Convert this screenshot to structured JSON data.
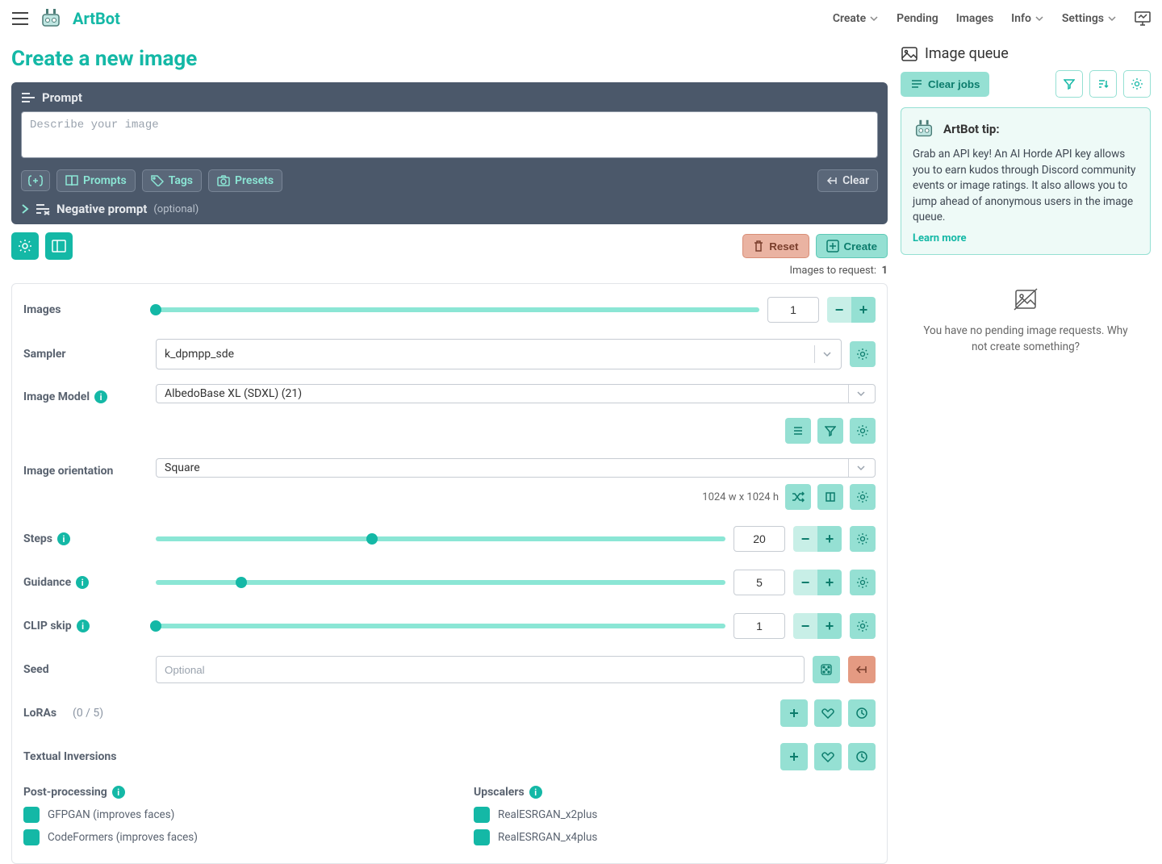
{
  "brand": "ArtBot",
  "nav": {
    "create": "Create",
    "pending": "Pending",
    "images": "Images",
    "info": "Info",
    "settings": "Settings"
  },
  "page_title": "Create a new image",
  "prompt": {
    "label": "Prompt",
    "placeholder": "Describe your image",
    "prompts_btn": "Prompts",
    "tags_btn": "Tags",
    "presets_btn": "Presets",
    "clear_btn": "Clear",
    "neg_label": "Negative prompt",
    "neg_optional": "(optional)"
  },
  "actions": {
    "reset": "Reset",
    "create": "Create",
    "images_to_request_label": "Images to request:",
    "images_to_request_value": "1"
  },
  "settings": {
    "images": {
      "label": "Images",
      "value": "1",
      "pct": 0
    },
    "sampler": {
      "label": "Sampler",
      "value": "k_dpmpp_sde"
    },
    "model": {
      "label": "Image Model",
      "value": "AlbedoBase XL (SDXL) (21)"
    },
    "orientation": {
      "label": "Image orientation",
      "value": "Square",
      "dims": "1024 w x 1024 h"
    },
    "steps": {
      "label": "Steps",
      "value": "20",
      "pct": 38
    },
    "guidance": {
      "label": "Guidance",
      "value": "5",
      "pct": 15
    },
    "clipskip": {
      "label": "CLIP skip",
      "value": "1",
      "pct": 0
    },
    "seed": {
      "label": "Seed",
      "placeholder": "Optional"
    },
    "loras": {
      "label": "LoRAs",
      "count": "(0 / 5)"
    },
    "ti": {
      "label": "Textual Inversions"
    },
    "pp": {
      "title": "Post-processing",
      "opt1": "GFPGAN (improves faces)",
      "opt2": "CodeFormers (improves faces)"
    },
    "upscalers": {
      "title": "Upscalers",
      "opt1": "RealESRGAN_x2plus",
      "opt2": "RealESRGAN_x4plus"
    }
  },
  "queue": {
    "title": "Image queue",
    "clear_jobs": "Clear jobs",
    "tip_title": "ArtBot tip:",
    "tip_body": "Grab an API key! An AI Horde API key allows you to earn kudos through Discord community events or image ratings. It also allows you to jump ahead of anonymous users in the image queue.",
    "learn_more": "Learn more",
    "empty_msg": "You have no pending image requests. Why not create something?"
  }
}
